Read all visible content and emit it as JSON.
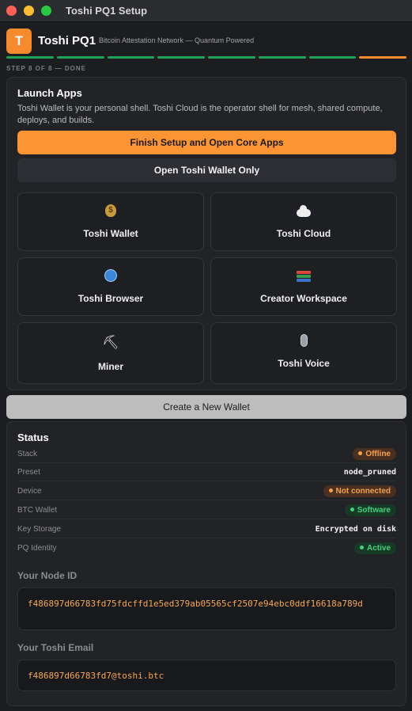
{
  "window": {
    "title": "Toshi PQ1 Setup"
  },
  "header": {
    "logo_letter": "T",
    "brand": "Toshi PQ1",
    "tagline": "Bitcoin Attestation Network — Quantum Powered",
    "progress": {
      "total_steps": 8,
      "completed_steps": 7,
      "current_step": 8
    },
    "step_label": "STEP 8 OF 8 — DONE"
  },
  "launch": {
    "title": "Launch Apps",
    "description": "Toshi Wallet is your personal shell. Toshi Cloud is the operator shell for mesh, shared compute, deploys, and builds.",
    "primary_button": "Finish Setup and Open Core Apps",
    "secondary_button": "Open Toshi Wallet Only",
    "apps": [
      {
        "icon": "money-bag-icon",
        "label": "Toshi Wallet"
      },
      {
        "icon": "cloud-icon",
        "label": "Toshi Cloud"
      },
      {
        "icon": "globe-icon",
        "label": "Toshi Browser"
      },
      {
        "icon": "books-icon",
        "label": "Creator Workspace"
      },
      {
        "icon": "pickaxe-icon",
        "label": "Miner"
      },
      {
        "icon": "microphone-icon",
        "label": "Toshi Voice"
      }
    ]
  },
  "create_wallet_button": "Create a New Wallet",
  "status": {
    "title": "Status",
    "rows": [
      {
        "key": "Stack",
        "value": "Offline",
        "style": "badge-orange"
      },
      {
        "key": "Preset",
        "value": "node_pruned",
        "style": "text"
      },
      {
        "key": "Device",
        "value": "Not connected",
        "style": "badge-orange"
      },
      {
        "key": "BTC Wallet",
        "value": "Software",
        "style": "badge-green"
      },
      {
        "key": "Key Storage",
        "value": "Encrypted on disk",
        "style": "text"
      },
      {
        "key": "PQ Identity",
        "value": "Active",
        "style": "badge-green"
      }
    ],
    "node_id_label": "Your Node ID",
    "node_id": "f486897d66783fd75fdcffd1e5ed379ab05565cf2507e94ebc0ddf16618a789d",
    "email_label": "Your Toshi Email",
    "email": "f486897d66783fd7@toshi.btc"
  },
  "colors": {
    "accent": "#f7892e",
    "progress_done": "#1fa055",
    "badge_orange": "#f5a24a",
    "badge_green": "#40d27e"
  }
}
